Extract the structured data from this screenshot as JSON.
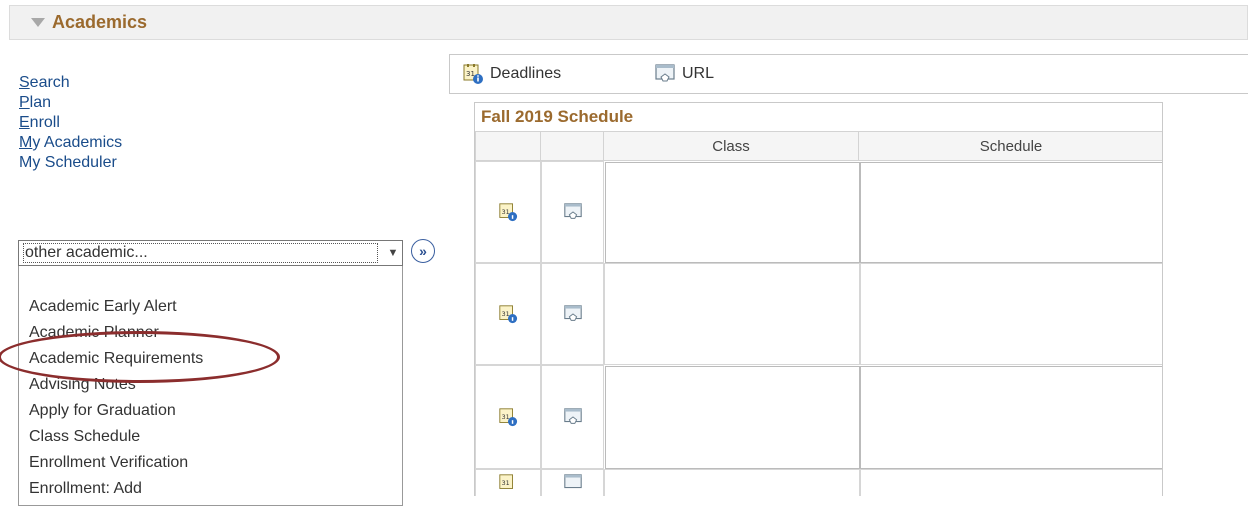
{
  "section": {
    "title": "Academics"
  },
  "nav_links": [
    {
      "accel": "S",
      "rest": "earch"
    },
    {
      "accel": "P",
      "rest": "lan"
    },
    {
      "accel": "E",
      "rest": "nroll"
    },
    {
      "accel": "M",
      "rest": "y Academics"
    },
    {
      "accel": "",
      "rest": "My Scheduler"
    }
  ],
  "select": {
    "value": "other academic..."
  },
  "dropdown_options": [
    "Academic Early Alert",
    "Academic Planner",
    "Academic Requirements",
    "Advising Notes",
    "Apply for Graduation",
    "Class Schedule",
    "Enrollment Verification",
    "Enrollment: Add"
  ],
  "toolbar": {
    "deadlines_label": "Deadlines",
    "url_label": "URL"
  },
  "schedule": {
    "title": "Fall 2019 Schedule",
    "columns": [
      "",
      "",
      "Class",
      "Schedule"
    ]
  },
  "colors": {
    "accent_brown": "#9b6a2e",
    "link_blue": "#1a4c8a",
    "highlight_circle": "#8b2d2d"
  }
}
